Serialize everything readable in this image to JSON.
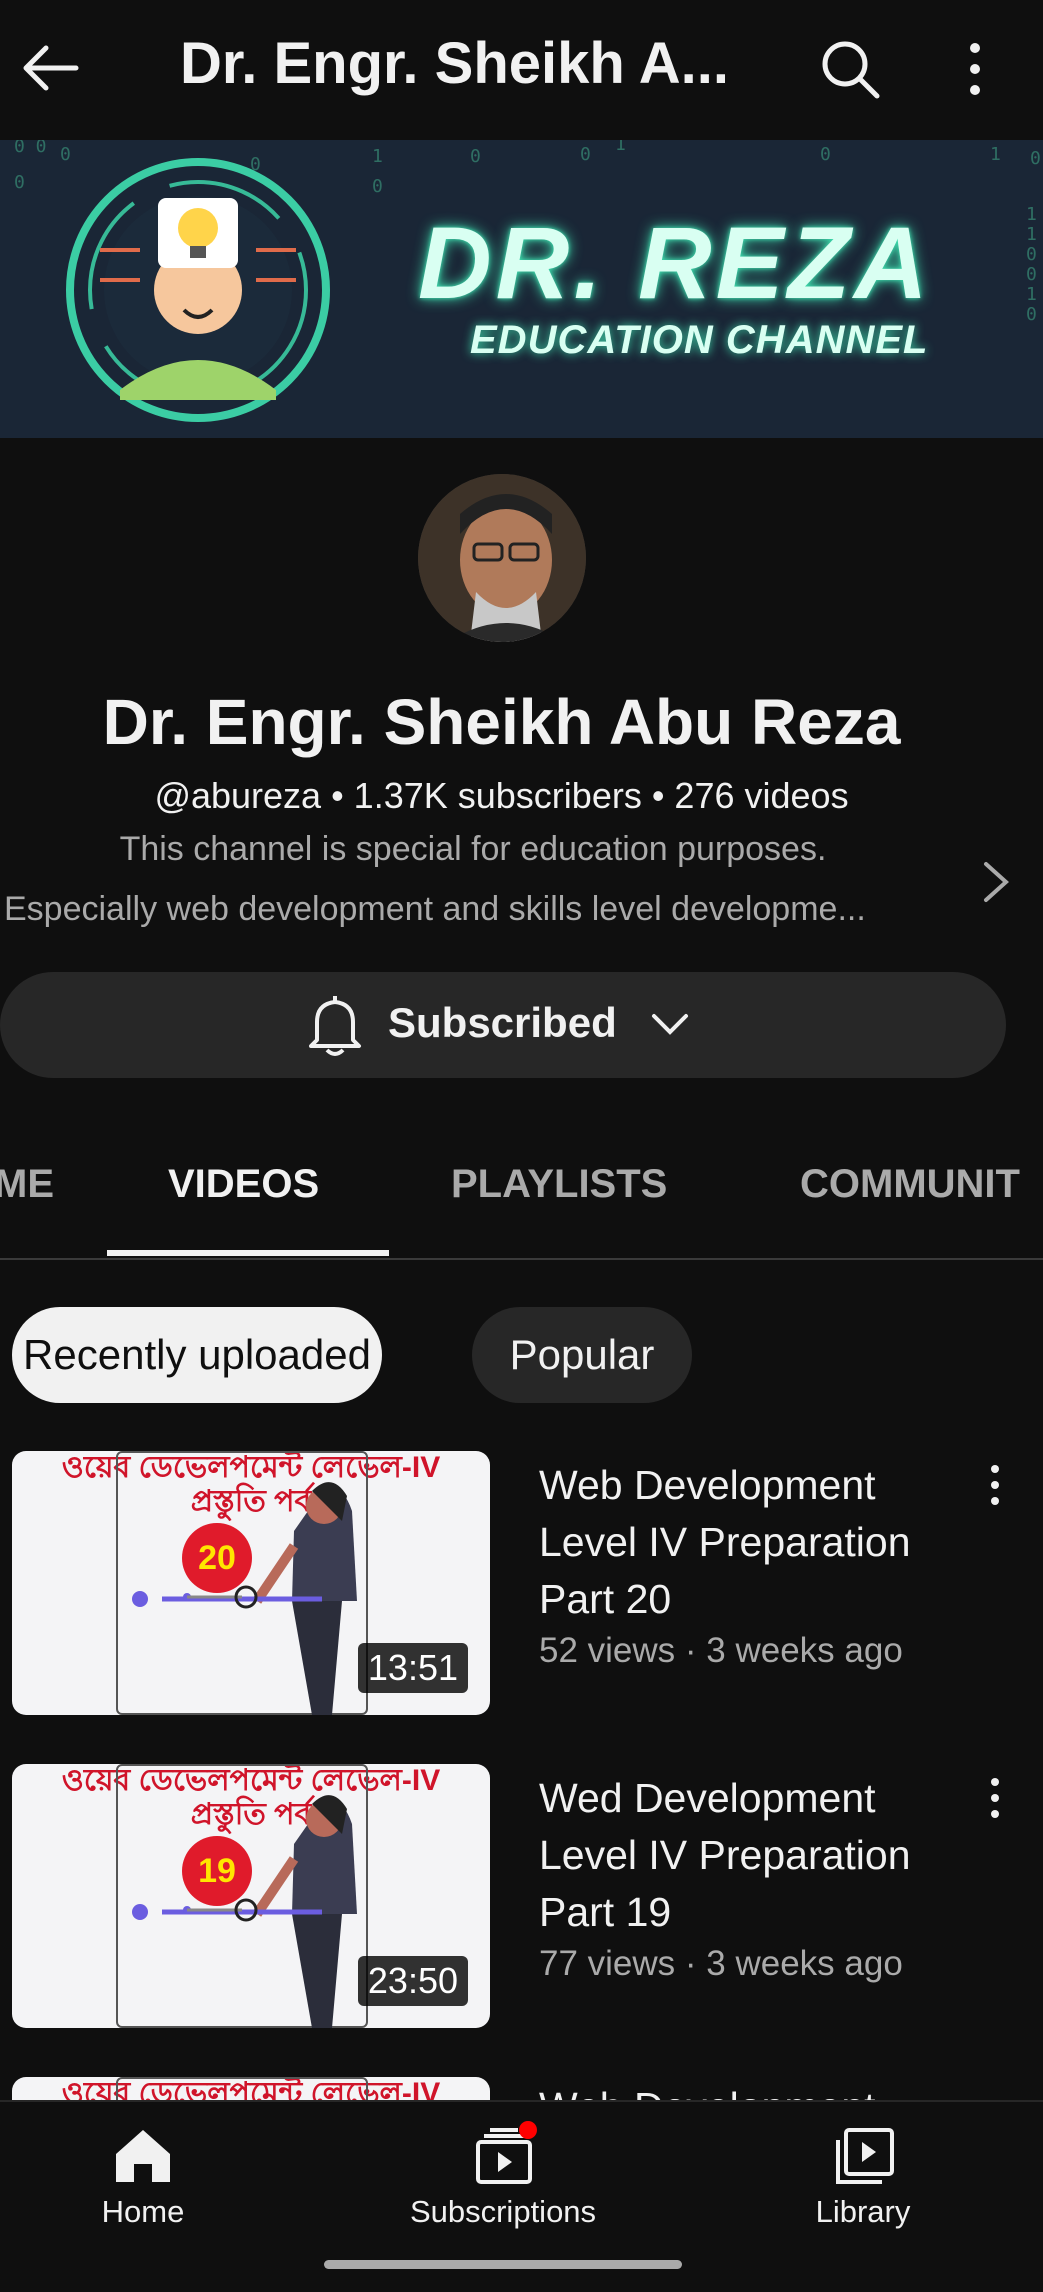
{
  "app_bar": {
    "title": "Dr. Engr. Sheikh A...",
    "back_icon": "arrow-left-icon",
    "search_icon": "search-icon",
    "more_icon": "more-vert-icon"
  },
  "banner": {
    "title": "DR. REZA",
    "subtitle": "EDUCATION CHANNEL",
    "accent": "#3fe0b0"
  },
  "channel": {
    "name": "Dr. Engr. Sheikh Abu Reza",
    "meta": "@abureza • 1.37K subscribers • 276 videos",
    "description_line1": "This channel is special for education purposes.",
    "description_line2": "Especially web development and skills level developme..."
  },
  "subscribe": {
    "label": "Subscribed",
    "bell_icon": "bell-icon",
    "chevron_icon": "chevron-down-icon"
  },
  "tabs": [
    {
      "label": "ME"
    },
    {
      "label": "VIDEOS"
    },
    {
      "label": "PLAYLISTS"
    },
    {
      "label": "COMMUNIT"
    }
  ],
  "chips": [
    {
      "label": "Recently uploaded"
    },
    {
      "label": "Popular"
    }
  ],
  "videos": [
    {
      "thumb_text": "ওয়েব ডেভেলপমেন্ট লেভেল-IV",
      "thumb_text2": "প্রস্তুতি পর্ব",
      "part": "20",
      "duration": "13:51",
      "title": "Web Development Level IV Preparation Part 20",
      "meta": "52 views · 3 weeks ago"
    },
    {
      "thumb_text": "ওয়েব ডেভেলপমেন্ট লেভেল-IV",
      "thumb_text2": "প্রস্তুতি পর্ব",
      "part": "19",
      "duration": "23:50",
      "title": "Wed Development Level IV Preparation Part 19",
      "meta": "77 views · 3 weeks ago"
    },
    {
      "thumb_text": "ওয়েব ডেভেলপমেন্ট লেভেল-IV",
      "title": "Web Development"
    }
  ],
  "bottom_nav": [
    {
      "label": "Home",
      "icon": "home-icon"
    },
    {
      "label": "Subscriptions",
      "icon": "subscriptions-icon"
    },
    {
      "label": "Library",
      "icon": "library-icon"
    }
  ]
}
